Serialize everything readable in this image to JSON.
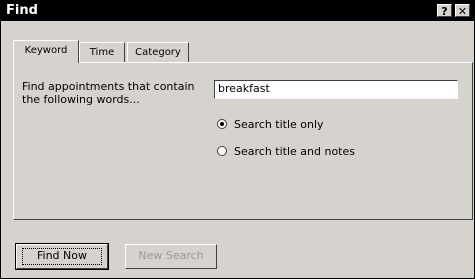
{
  "window": {
    "title": "Find",
    "help_glyph": "?",
    "close_glyph": "✕"
  },
  "tabs": [
    {
      "label": "Keyword"
    },
    {
      "label": "Time"
    },
    {
      "label": "Category"
    }
  ],
  "keyword": {
    "prompt": "Find appointments that contain the following words...",
    "value": "breakfast",
    "options": [
      {
        "label": "Search title only",
        "checked": true
      },
      {
        "label": "Search title and notes",
        "checked": false
      }
    ]
  },
  "buttons": {
    "find_now": "Find Now",
    "new_search": "New Search"
  }
}
